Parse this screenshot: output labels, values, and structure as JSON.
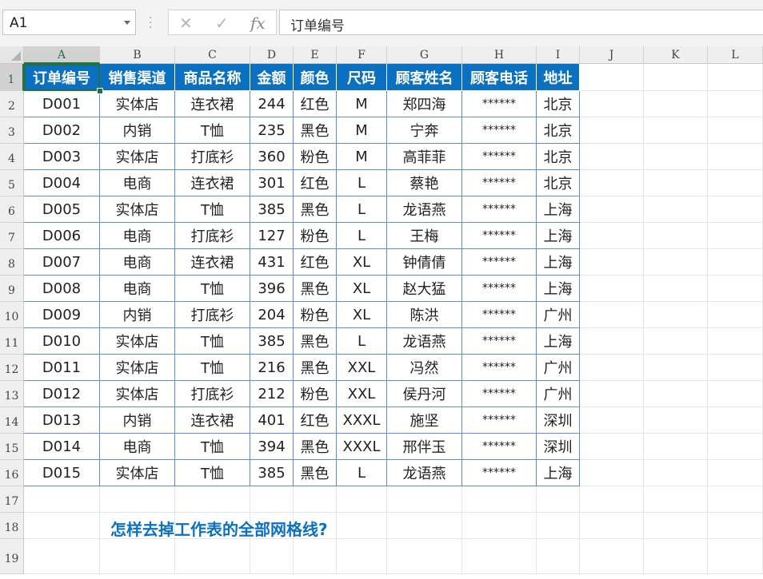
{
  "formula_bar": {
    "name_box": "A1",
    "cancel_icon": "✕",
    "enter_icon": "✓",
    "fx_label": "fx",
    "formula": "订单编号"
  },
  "columns": [
    "A",
    "B",
    "C",
    "D",
    "E",
    "F",
    "G",
    "H",
    "I",
    "J",
    "K",
    "L"
  ],
  "rows": [
    "1",
    "2",
    "3",
    "4",
    "5",
    "6",
    "7",
    "8",
    "9",
    "10",
    "11",
    "12",
    "13",
    "14",
    "15",
    "16",
    "17",
    "18",
    "19"
  ],
  "table": {
    "headers": [
      "订单编号",
      "销售渠道",
      "商品名称",
      "金额",
      "颜色",
      "尺码",
      "顾客姓名",
      "顾客电话",
      "地址"
    ],
    "rows": [
      [
        "D001",
        "实体店",
        "连衣裙",
        "244",
        "红色",
        "M",
        "郑四海",
        "******",
        "北京"
      ],
      [
        "D002",
        "内销",
        "T恤",
        "235",
        "黑色",
        "M",
        "宁奔",
        "******",
        "北京"
      ],
      [
        "D003",
        "实体店",
        "打底衫",
        "360",
        "粉色",
        "M",
        "高菲菲",
        "******",
        "北京"
      ],
      [
        "D004",
        "电商",
        "连衣裙",
        "301",
        "红色",
        "L",
        "蔡艳",
        "******",
        "北京"
      ],
      [
        "D005",
        "实体店",
        "T恤",
        "385",
        "黑色",
        "L",
        "龙语燕",
        "******",
        "上海"
      ],
      [
        "D006",
        "电商",
        "打底衫",
        "127",
        "粉色",
        "L",
        "王梅",
        "******",
        "上海"
      ],
      [
        "D007",
        "电商",
        "连衣裙",
        "431",
        "红色",
        "XL",
        "钟倩倩",
        "******",
        "上海"
      ],
      [
        "D008",
        "电商",
        "T恤",
        "396",
        "黑色",
        "XL",
        "赵大猛",
        "******",
        "上海"
      ],
      [
        "D009",
        "内销",
        "打底衫",
        "204",
        "粉色",
        "XL",
        "陈洪",
        "******",
        "广州"
      ],
      [
        "D010",
        "实体店",
        "T恤",
        "385",
        "黑色",
        "L",
        "龙语燕",
        "******",
        "上海"
      ],
      [
        "D011",
        "实体店",
        "T恤",
        "216",
        "黑色",
        "XXL",
        "冯然",
        "******",
        "广州"
      ],
      [
        "D012",
        "实体店",
        "打底衫",
        "212",
        "粉色",
        "XXL",
        "侯丹河",
        "******",
        "广州"
      ],
      [
        "D013",
        "内销",
        "连衣裙",
        "401",
        "红色",
        "XXXL",
        "施坚",
        "******",
        "深圳"
      ],
      [
        "D014",
        "电商",
        "T恤",
        "394",
        "黑色",
        "XXXL",
        "邢伴玉",
        "******",
        "深圳"
      ],
      [
        "D015",
        "实体店",
        "T恤",
        "385",
        "黑色",
        "L",
        "龙语燕",
        "******",
        "上海"
      ]
    ]
  },
  "question": "怎样去掉工作表的全部网格线?",
  "colors": {
    "header_fill": "#0c70c0",
    "header_text": "#ffffff",
    "table_border": "#5b8fc7",
    "selection": "#217346",
    "question_text": "#0c70c0"
  }
}
